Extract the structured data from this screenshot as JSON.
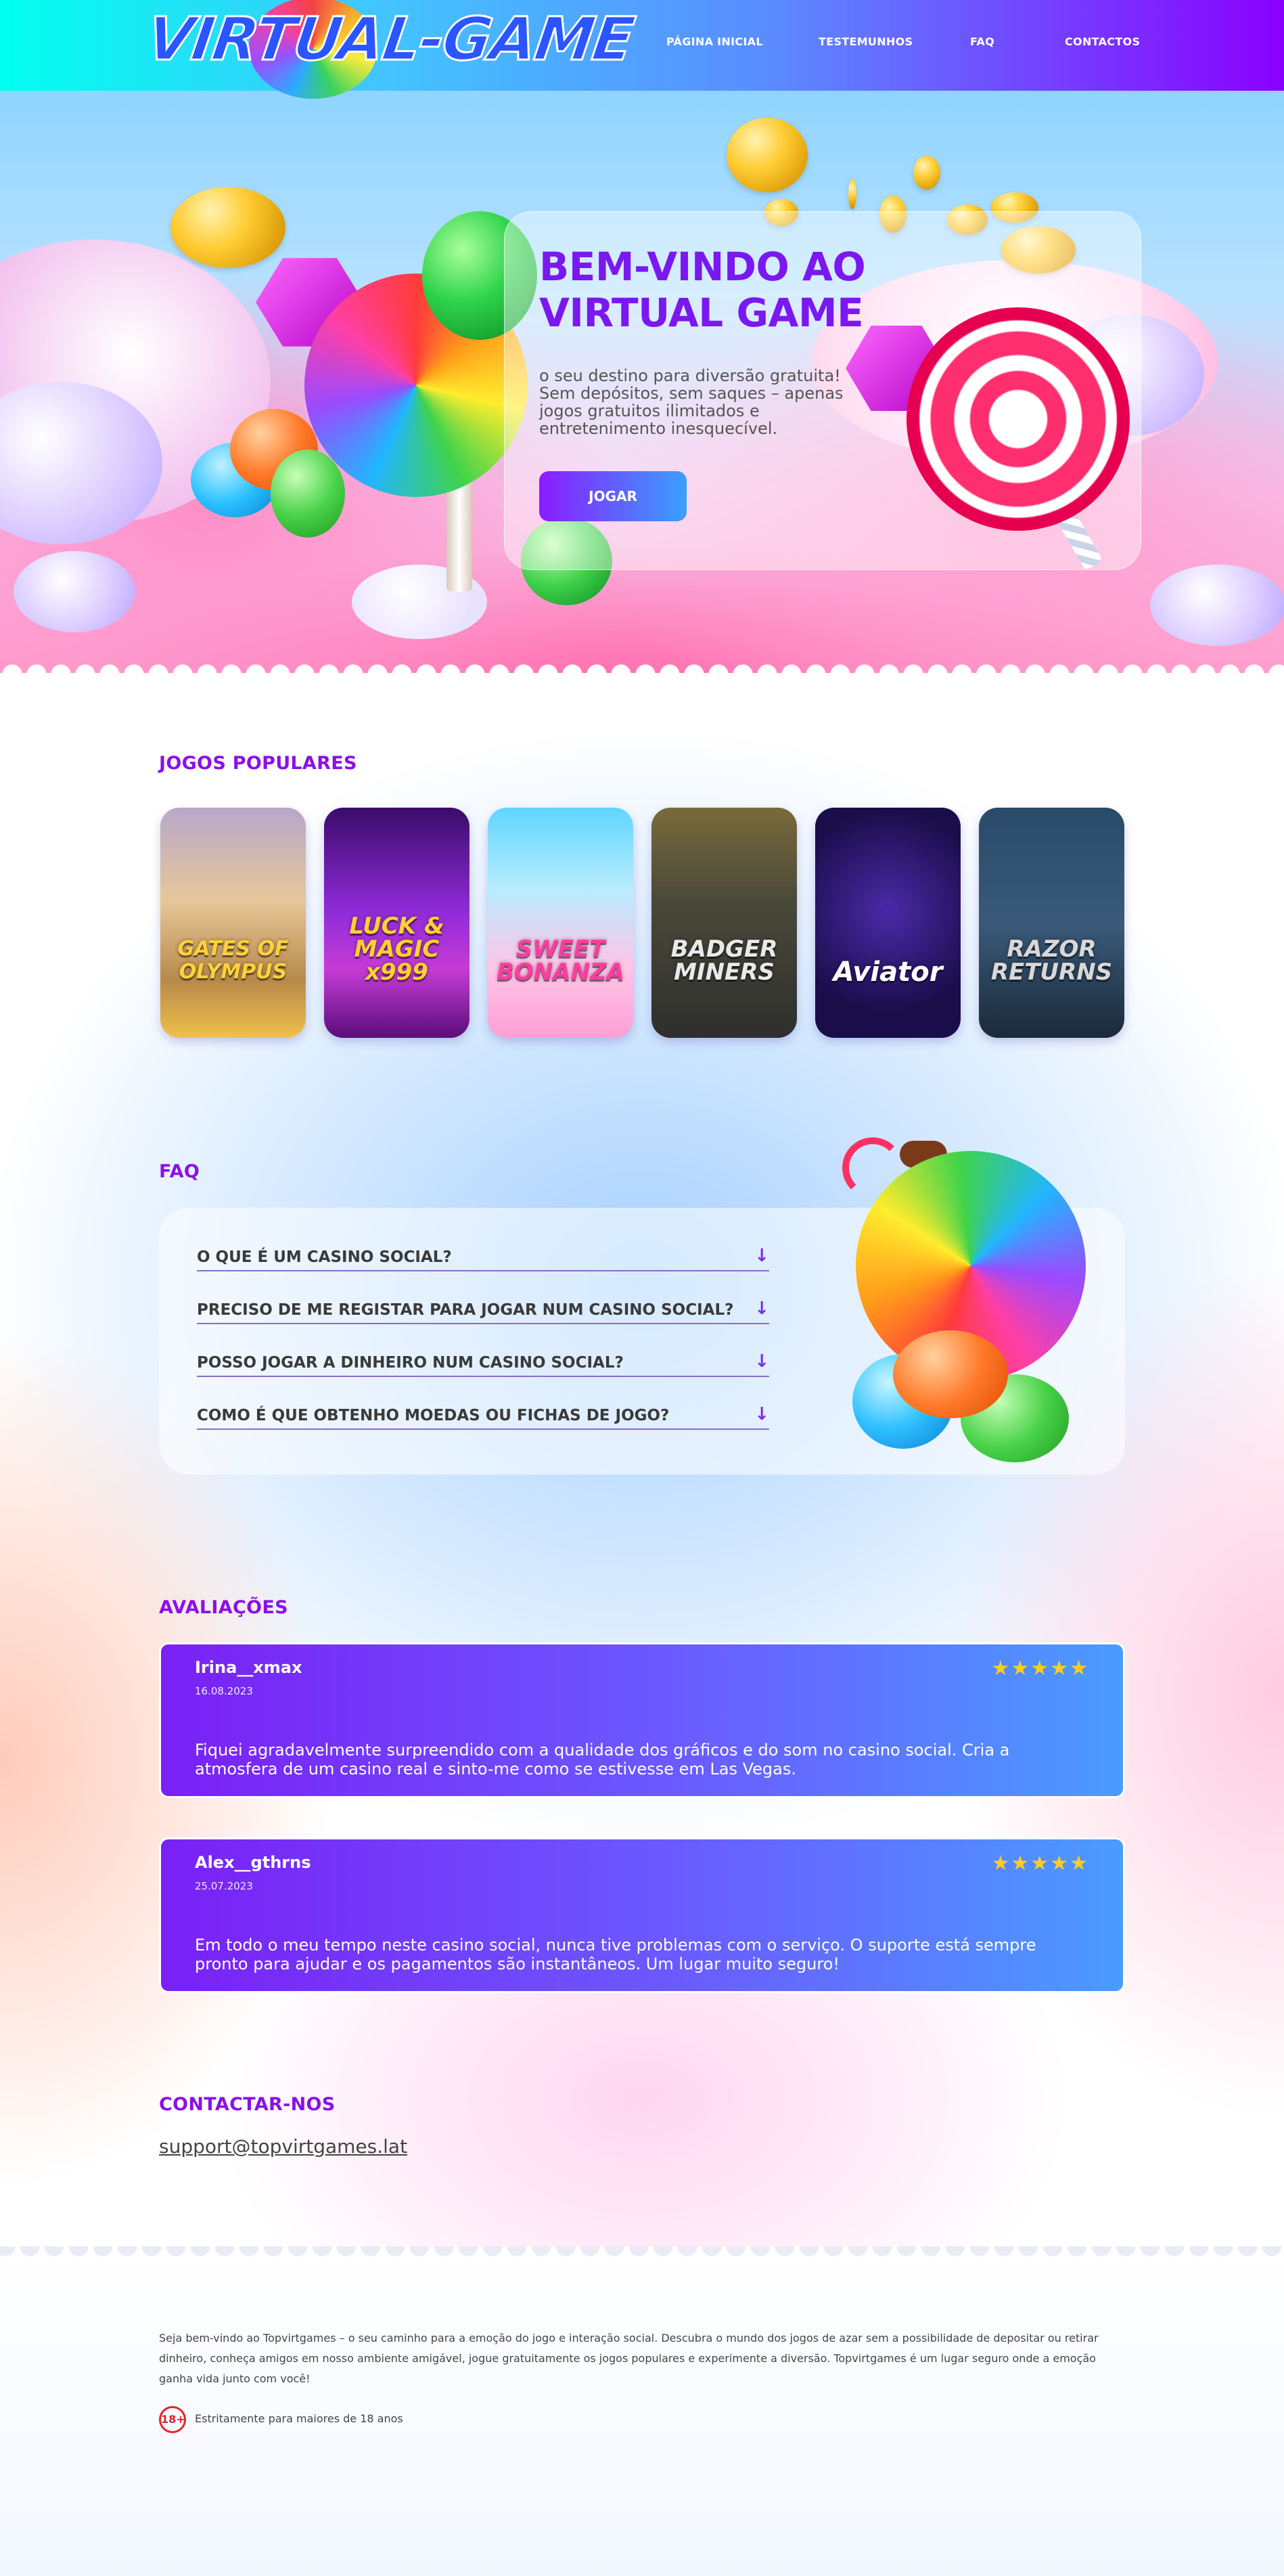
{
  "header": {
    "logo_text": "VIRTUAL-GAME",
    "nav": [
      {
        "label": "PÁGINA INICIAL"
      },
      {
        "label": "TESTEMUNHOS"
      },
      {
        "label": "FAQ"
      },
      {
        "label": "CONTACTOS"
      }
    ]
  },
  "hero": {
    "title": "BEM-VINDO AO VIRTUAL GAME",
    "subtitle": "o seu destino para diversão gratuita! Sem depósitos, sem saques – apenas jogos gratuitos ilimitados e entretenimento inesquecível.",
    "button_label": "JOGAR"
  },
  "popular": {
    "title": "JOGOS POPULARES",
    "games": [
      {
        "name": "GATES OF OLYMPUS"
      },
      {
        "name": "LUCK & MAGIC x999"
      },
      {
        "name": "SWEET BONANZA"
      },
      {
        "name": "BADGER MINERS"
      },
      {
        "name": "Aviator"
      },
      {
        "name": "RAZOR RETURNS"
      }
    ]
  },
  "faq": {
    "title": "FAQ",
    "items": [
      {
        "question": "O QUE É UM CASINO SOCIAL?"
      },
      {
        "question": "PRECISO DE ME REGISTAR PARA JOGAR NUM CASINO SOCIAL?"
      },
      {
        "question": "POSSO JOGAR A DINHEIRO NUM CASINO SOCIAL?"
      },
      {
        "question": "COMO É QUE OBTENHO MOEDAS OU FICHAS DE JOGO?"
      }
    ]
  },
  "reviews": {
    "title": "AVALIAÇÕES",
    "items": [
      {
        "name": "Irina__xmax",
        "date": "16.08.2023",
        "stars": "★★★★★",
        "text": "Fiquei agradavelmente surpreendido com a qualidade dos gráficos e do som no casino social. Cria a atmosfera de um casino real e sinto-me como se estivesse em Las Vegas."
      },
      {
        "name": "Alex__gthrns",
        "date": "25.07.2023",
        "stars": "★★★★★",
        "text": "Em todo o meu tempo neste casino social, nunca tive problemas com o serviço. O suporte está sempre pronto para ajudar e os pagamentos são instantâneos. Um lugar muito seguro!"
      }
    ]
  },
  "contact": {
    "title": "CONTACTAR-NOS",
    "email": "support@topvirtgames.lat"
  },
  "footer": {
    "text": "Seja bem-vindo ao Topvirtgames – o seu caminho para a emoção do jogo e interação social. Descubra o mundo dos jogos de azar sem a possibilidade de depositar ou retirar dinheiro, conheça amigos em nosso ambiente amigável, jogue gratuitamente os jogos populares e experimente a diversão. Topvirtgames é um lugar seguro onde a emoção ganha vida junto com você!",
    "age_badge": "18+",
    "age_text": "Estritamente para maiores de 18 anos"
  },
  "colors": {
    "accent_purple": "#8a10e8",
    "header_start": "#00ffee",
    "header_end": "#8a00ff",
    "star": "#ffcc1f"
  },
  "icons": {
    "faq_toggle": "arrow-down-icon",
    "star": "star-icon",
    "age": "age-18-icon"
  }
}
